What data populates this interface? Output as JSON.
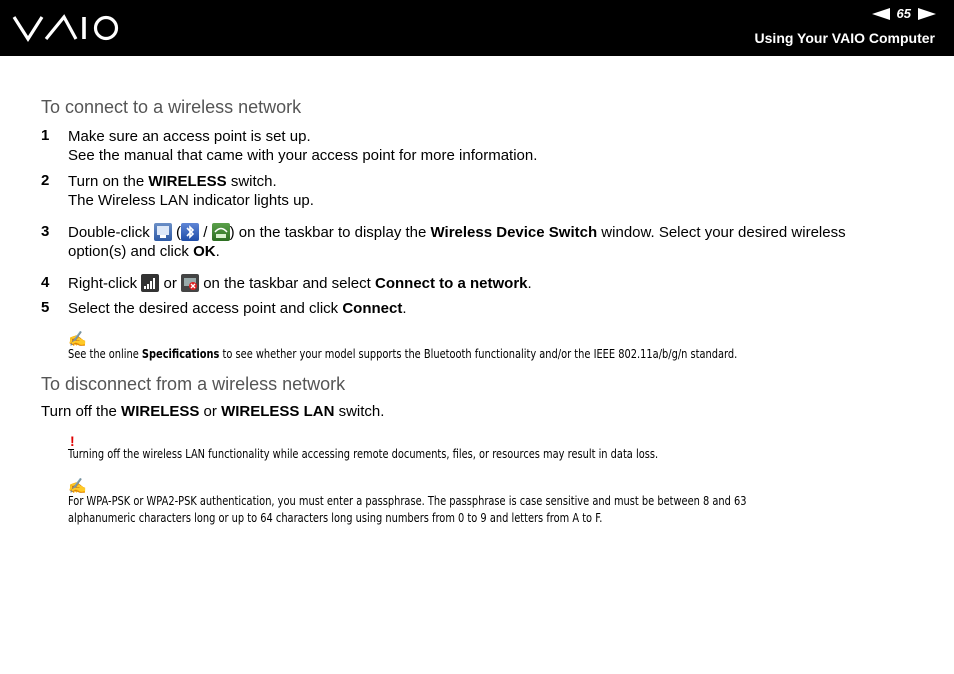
{
  "header": {
    "logo_text": "VAIO",
    "page_number": "65",
    "section_title": "Using Your VAIO Computer"
  },
  "connect": {
    "title": "To connect to a wireless network",
    "steps": [
      {
        "num": "1",
        "line1": "Make sure an access point is set up.",
        "line2": "See the manual that came with your access point for more information."
      },
      {
        "num": "2",
        "pre": "Turn on the ",
        "bold": "WIRELESS",
        "post": " switch.",
        "line2": "The Wireless LAN indicator lights up."
      },
      {
        "num": "3",
        "pre": "Double-click ",
        "mid1": " (",
        "mid2": " / ",
        "mid3": ") on the taskbar to display the ",
        "bold": "Wireless Device Switch",
        "post": " window. Select your desired wireless",
        "line2_pre": "option(s) and click ",
        "line2_bold": "OK",
        "line2_post": "."
      },
      {
        "num": "4",
        "pre": "Right-click ",
        "mid": " or ",
        "mid2": " on the taskbar and select ",
        "bold": "Connect to a network",
        "post": "."
      },
      {
        "num": "5",
        "pre": "Select the desired access point and click ",
        "bold": "Connect",
        "post": "."
      }
    ],
    "note": {
      "pre": "See the online ",
      "bold": "Specifications",
      "post": " to see whether your model supports the Bluetooth functionality and/or the IEEE 802.11a/b/g/n standard."
    }
  },
  "disconnect": {
    "title": "To disconnect from a wireless network",
    "line": {
      "pre": "Turn off the ",
      "bold1": "WIRELESS",
      "mid": " or ",
      "bold2": "WIRELESS LAN",
      "post": " switch."
    },
    "warning_mark": "!",
    "warning": "Turning off the wireless LAN functionality while accessing remote documents, files, or resources may result in data loss.",
    "note_line1": "For WPA-PSK or WPA2-PSK authentication, you must enter a passphrase. The passphrase is case sensitive and must be between 8 and 63",
    "note_line2": "alphanumeric characters long or up to 64 characters long using numbers from 0 to 9 and letters from A to F."
  },
  "icons": [
    "wireless-switch-icon",
    "bluetooth-icon",
    "lan-icon",
    "wlan-signal-icon",
    "wlan-disconnected-icon",
    "note-pencil-icon"
  ],
  "colors": {
    "header_bg": "#000000",
    "heading_gray": "#555555",
    "warning_red": "#e00000",
    "note_green": "#2e7d32"
  }
}
